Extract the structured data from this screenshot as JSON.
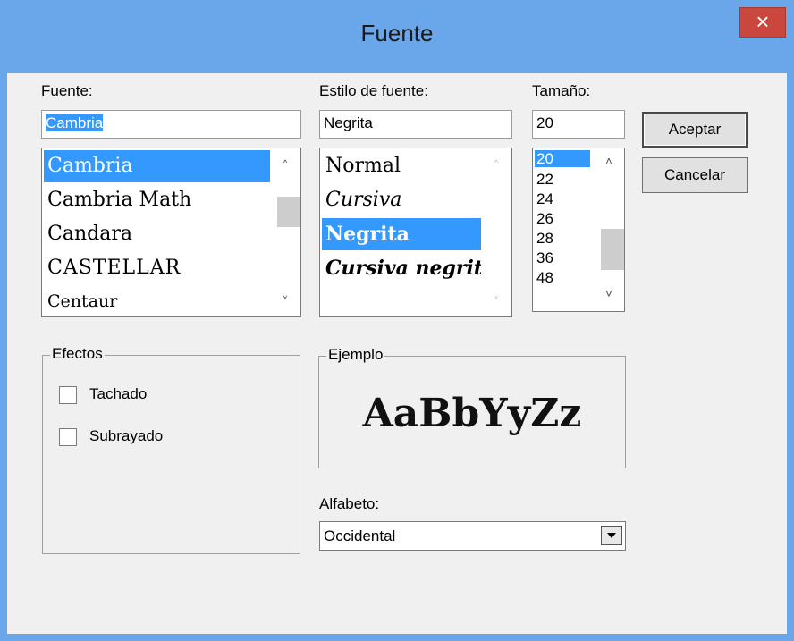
{
  "window": {
    "title": "Fuente",
    "close_label": "×"
  },
  "font": {
    "label": "Fuente:",
    "value": "Cambria",
    "items": [
      "Cambria",
      "Cambria Math",
      "Candara",
      "CASTELLAR",
      "Centaur"
    ]
  },
  "style": {
    "label": "Estilo de fuente:",
    "value": "Negrita",
    "items": [
      "Normal",
      "Cursiva",
      "Negrita",
      "Cursiva negrita"
    ]
  },
  "size": {
    "label": "Tamaño:",
    "value": "20",
    "items": [
      "20",
      "22",
      "24",
      "26",
      "28",
      "36",
      "48"
    ]
  },
  "buttons": {
    "ok": "Aceptar",
    "cancel": "Cancelar"
  },
  "effects": {
    "title": "Efectos",
    "strike_label": "Tachado",
    "strike_checked": false,
    "underline_label": "Subrayado",
    "underline_checked": false
  },
  "sample": {
    "title": "Ejemplo",
    "text": "AaBbYyZz"
  },
  "script": {
    "label": "Alfabeto:",
    "value": "Occidental"
  },
  "colors": {
    "title_bar": "#6aa7ea",
    "selection": "#3399ff",
    "close": "#c9473d"
  }
}
